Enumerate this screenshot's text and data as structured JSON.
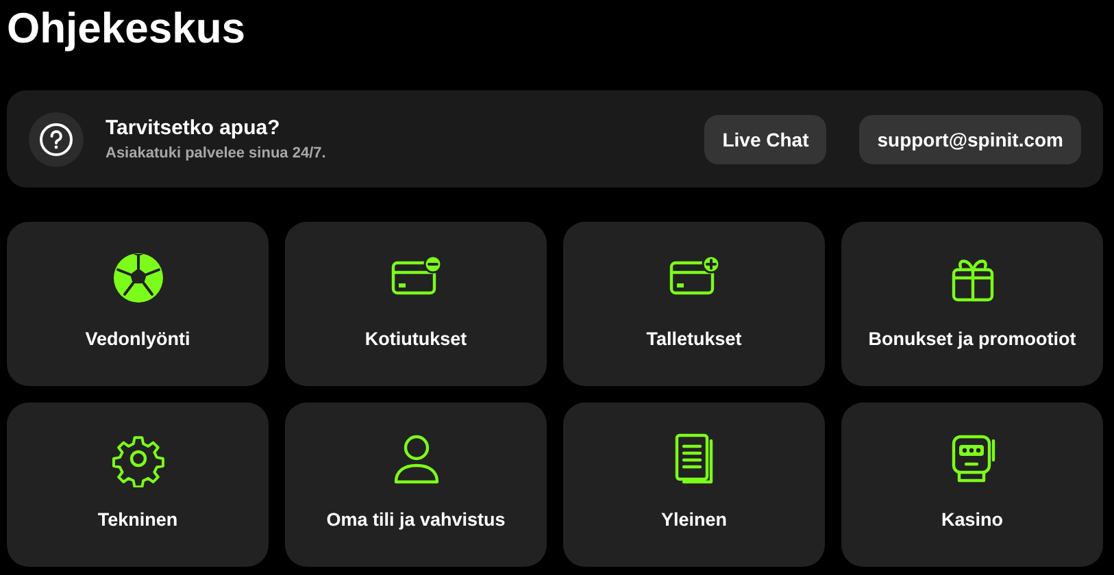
{
  "page_title": "Ohjekeskus",
  "help": {
    "title": "Tarvitsetko apua?",
    "subtitle": "Asiakatuki palvelee sinua 24/7.",
    "buttons": [
      "Live Chat",
      "support@spinit.com"
    ]
  },
  "categories": [
    {
      "label": "Vedonlyönti"
    },
    {
      "label": "Kotiutukset"
    },
    {
      "label": "Talletukset"
    },
    {
      "label": "Bonukset ja promootiot"
    },
    {
      "label": "Tekninen"
    },
    {
      "label": "Oma tili ja vahvistus"
    },
    {
      "label": "Yleinen"
    },
    {
      "label": "Kasino"
    }
  ]
}
